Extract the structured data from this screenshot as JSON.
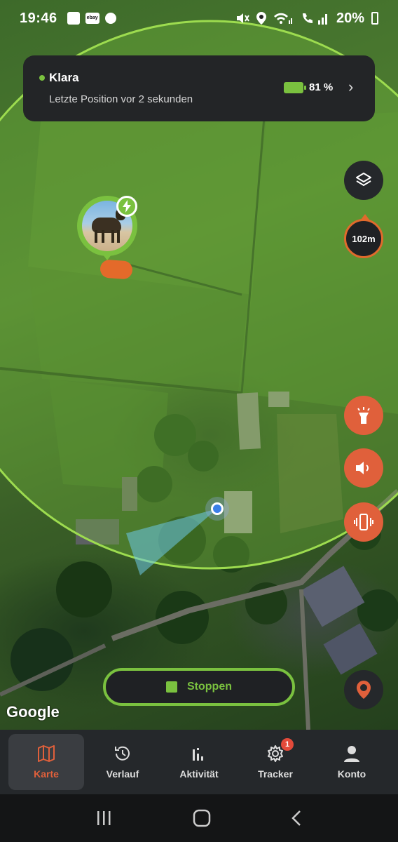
{
  "status_bar": {
    "time": "19:46",
    "battery_percent": "20%",
    "left_icons": [
      "gallery-icon",
      "ebay-icon",
      "timer-icon"
    ],
    "right_icons": [
      "mute-icon",
      "location-icon",
      "wifi-icon",
      "call-wifi-icon",
      "signal-icon",
      "battery-icon"
    ],
    "ebay_text": "ebay"
  },
  "tracker_card": {
    "name": "Klara",
    "last_position": "Letzte Position vor 2 sekunden",
    "battery_level": 0.81,
    "battery_text": "81 %",
    "online_color": "#7ac13f"
  },
  "map": {
    "range_label": "102m",
    "stop_label": "Stoppen",
    "attribution": "Google",
    "buttons": [
      "layers-icon",
      "flashlight-icon",
      "sound-icon",
      "vibrate-icon",
      "location-pin-icon"
    ]
  },
  "nav": {
    "items": [
      {
        "label": "Karte",
        "icon": "map-icon",
        "active": true
      },
      {
        "label": "Verlauf",
        "icon": "history-icon",
        "active": false
      },
      {
        "label": "Aktivität",
        "icon": "activity-icon",
        "active": false
      },
      {
        "label": "Tracker",
        "icon": "settings-icon",
        "active": false,
        "badge": "1"
      },
      {
        "label": "Konto",
        "icon": "account-icon",
        "active": false
      }
    ]
  },
  "colors": {
    "accent_green": "#7ac13f",
    "accent_orange": "#e0603b",
    "panel_dark": "#25282b"
  }
}
